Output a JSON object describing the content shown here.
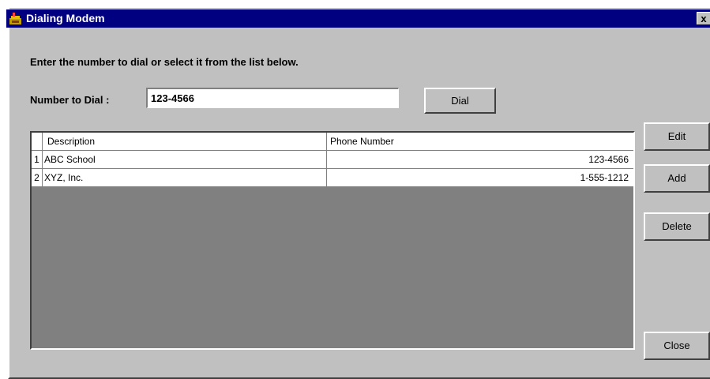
{
  "window": {
    "title": "Dialing Modem",
    "close_glyph": "x",
    "icon": "telephone-icon"
  },
  "instruction": "Enter the number to dial or select it from the list below.",
  "dial": {
    "label": "Number to Dial :",
    "value": "123-4566",
    "button_label": "Dial"
  },
  "grid": {
    "headers": {
      "description": "Description",
      "phone": "Phone Number"
    },
    "rows": [
      {
        "index": "1",
        "description": "ABC School",
        "phone": "123-4566"
      },
      {
        "index": "2",
        "description": "XYZ, Inc.",
        "phone": "1-555-1212"
      }
    ]
  },
  "actions": {
    "edit": "Edit",
    "add": "Add",
    "delete": "Delete",
    "close": "Close"
  },
  "colors": {
    "titlebar": "#000080",
    "face": "#c0c0c0",
    "grid_background": "#808080"
  }
}
